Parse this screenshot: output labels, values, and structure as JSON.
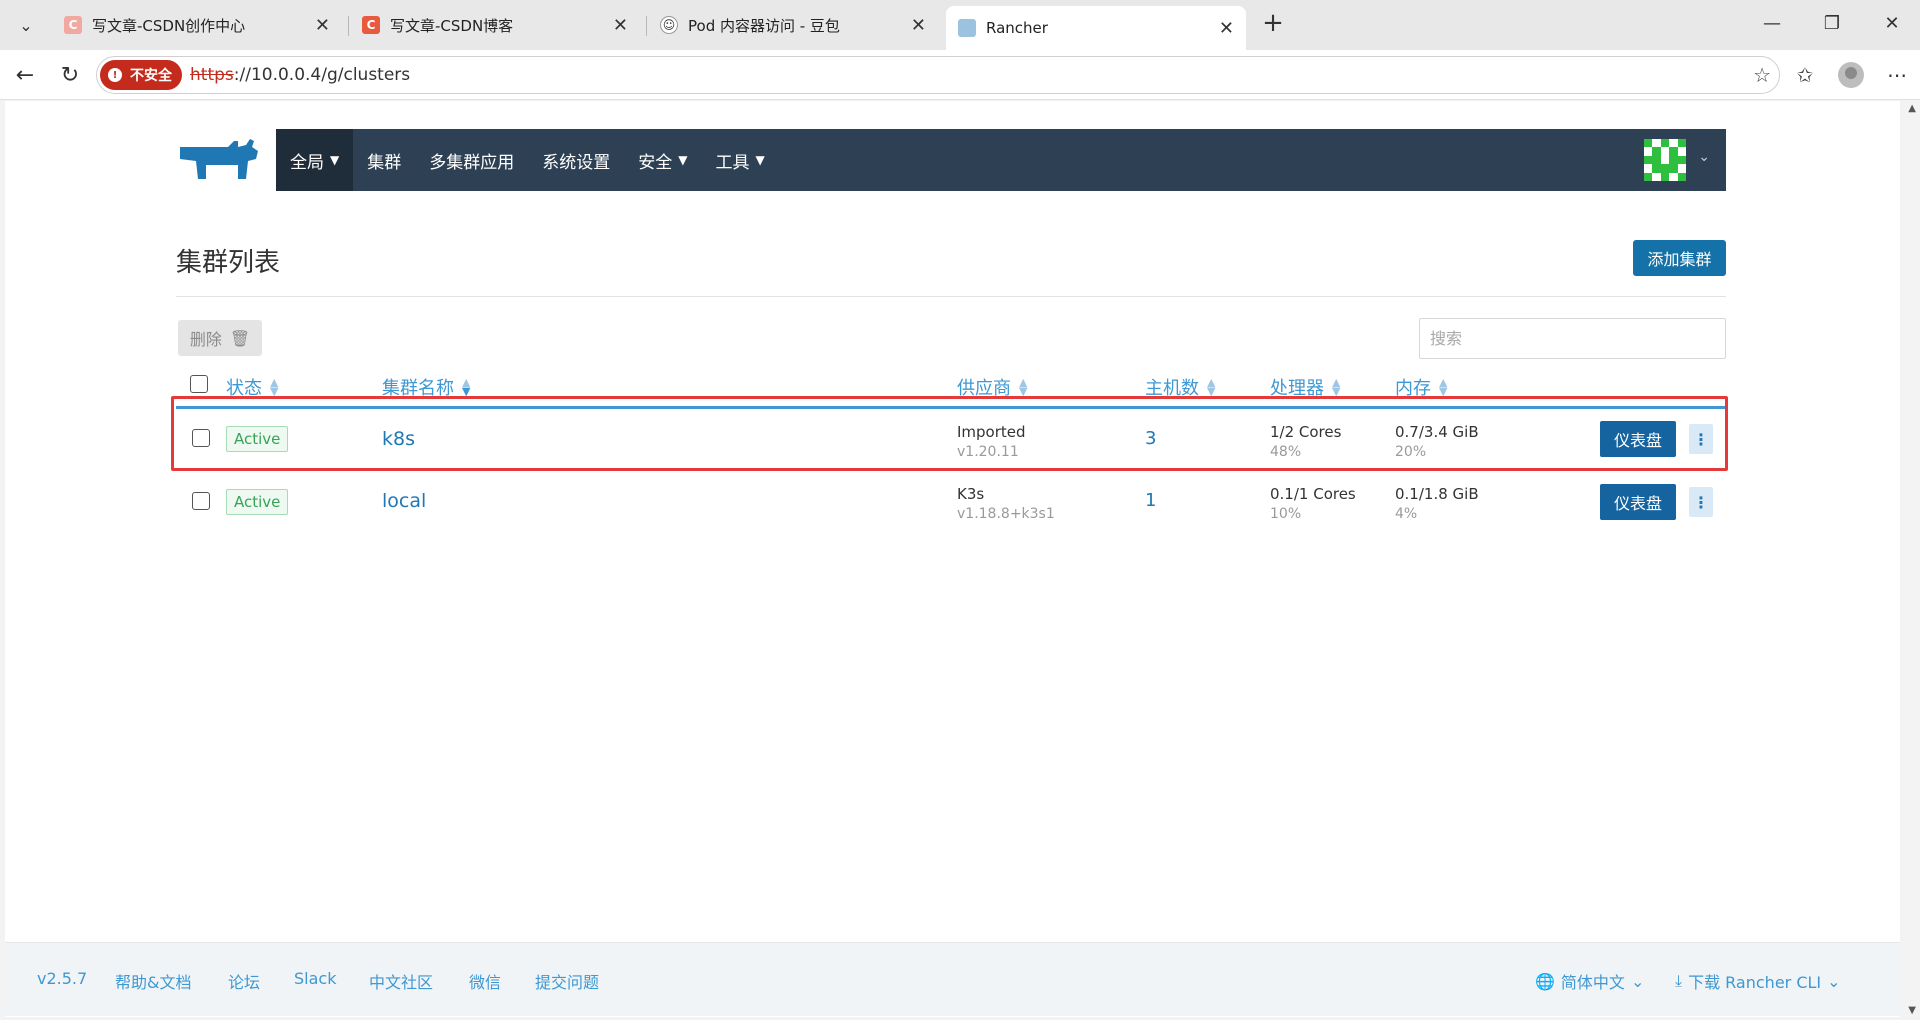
{
  "browser": {
    "tabs": [
      {
        "title": "写文章-CSDN创作中心",
        "favicon": "csdn-icon"
      },
      {
        "title": "写文章-CSDN博客",
        "favicon": "csdn-icon"
      },
      {
        "title": "Pod 内容器访问 - 豆包",
        "favicon": "doubao-icon"
      },
      {
        "title": "Rancher",
        "favicon": "rancher-icon",
        "active": true
      }
    ],
    "security_label": "不安全",
    "url_scheme": "https",
    "url_rest": "://10.0.0.4/g/clusters"
  },
  "nav": {
    "items": [
      {
        "label": "全局",
        "dropdown": true
      },
      {
        "label": "集群",
        "dropdown": false
      },
      {
        "label": "多集群应用",
        "dropdown": false
      },
      {
        "label": "系统设置",
        "dropdown": false
      },
      {
        "label": "安全",
        "dropdown": true
      },
      {
        "label": "工具",
        "dropdown": true
      }
    ]
  },
  "page": {
    "title": "集群列表",
    "add_button": "添加集群",
    "delete_button": "删除",
    "search_placeholder": "搜索"
  },
  "table": {
    "headers": {
      "state": "状态",
      "name": "集群名称",
      "provider": "供应商",
      "hosts": "主机数",
      "cpu": "处理器",
      "memory": "内存"
    },
    "rows": [
      {
        "state": "Active",
        "name": "k8s",
        "provider": "Imported",
        "version": "v1.20.11",
        "hosts": "3",
        "cpu": "1/2 Cores",
        "cpu_pct": "48%",
        "memory": "0.7/3.4 GiB",
        "memory_pct": "20%",
        "dashboard": "仪表盘",
        "highlighted": true
      },
      {
        "state": "Active",
        "name": "local",
        "provider": "K3s",
        "version": "v1.18.8+k3s1",
        "hosts": "1",
        "cpu": "0.1/1 Cores",
        "cpu_pct": "10%",
        "memory": "0.1/1.8 GiB",
        "memory_pct": "4%",
        "dashboard": "仪表盘",
        "highlighted": false
      }
    ]
  },
  "footer": {
    "version": "v2.5.7",
    "links": [
      "帮助&文档",
      "论坛",
      "Slack",
      "中文社区",
      "微信",
      "提交问题"
    ],
    "language": "简体中文",
    "cli": "下载 Rancher CLI"
  },
  "colors": {
    "nav_bg": "#2e4154",
    "primary": "#1572a8",
    "link": "#3d98d3",
    "active_badge": "#37a455",
    "highlight_border": "#e53a3a"
  }
}
